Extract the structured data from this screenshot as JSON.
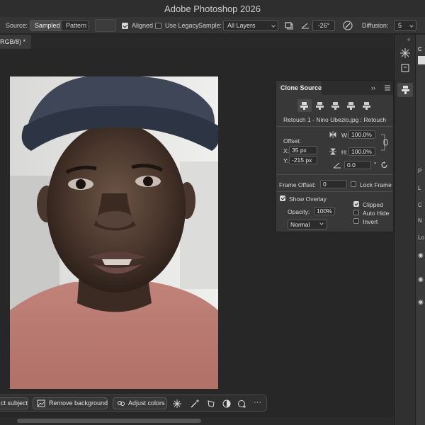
{
  "app": {
    "title": "Adobe Photoshop 2026"
  },
  "options": {
    "source_label": "Source:",
    "source_sampled": "Sampled",
    "source_pattern": "Pattern",
    "aligned_label": "Aligned",
    "aligned_checked": true,
    "use_legacy_label": "Use Legacy",
    "use_legacy_checked": false,
    "sample_label": "Sample:",
    "sample_value": "All Layers",
    "angle_value": "-26°",
    "diffusion_label": "Diffusion:",
    "diffusion_value": "5"
  },
  "document": {
    "tab_title": "RGB/8) *"
  },
  "clone_source": {
    "title": "Clone Source",
    "source_name": "Retouch 1 - Nino Ubezio.jpg : Retouch",
    "offset_label": "Offset:",
    "x_label": "X:",
    "x_value": "35 px",
    "y_label": "Y:",
    "y_value": "-215 px",
    "w_label": "W:",
    "w_value": "100.0%",
    "h_label": "H:",
    "h_value": "100.0%",
    "angle_value": "0.0",
    "angle_unit": "°",
    "frame_offset_label": "Frame Offset:",
    "frame_offset_value": "0",
    "lock_frame_label": "Lock Frame",
    "lock_frame_checked": false,
    "show_overlay_label": "Show Overlay",
    "show_overlay_checked": true,
    "opacity_label": "Opacity:",
    "opacity_value": "100%",
    "clipped_label": "Clipped",
    "clipped_checked": true,
    "auto_hide_label": "Auto Hide",
    "auto_hide_checked": false,
    "invert_label": "Invert",
    "invert_checked": false,
    "blend_mode": "Normal"
  },
  "context_bar": {
    "select_subject": "ct subject",
    "remove_background": "Remove background",
    "adjust_colors": "Adjust colors",
    "more": "···"
  },
  "right_panel_fragments": [
    "C",
    "P",
    "L",
    "C",
    "N",
    "Lo"
  ],
  "colors": {
    "accent": "#d8d8d8",
    "panel": "#383838",
    "chrome": "#353535"
  }
}
